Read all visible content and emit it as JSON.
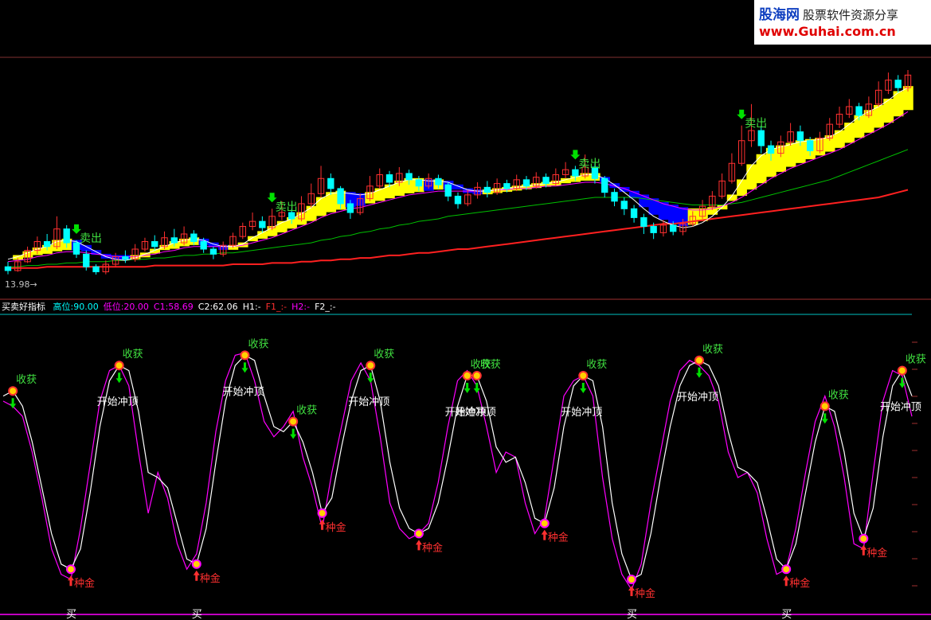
{
  "watermark": {
    "brand": "股海网",
    "slogan": "股票软件资源分享",
    "url": "www.Guhai.com.cn"
  },
  "price_panel": {
    "low_marker": "13.98",
    "sell_signal_label": "卖出",
    "colors": {
      "up": "#ff3030",
      "down": "#00ffff",
      "band_up": "#ffff00",
      "band_down": "#0000ff",
      "ma_white": "#ffffff",
      "ma_magenta": "#ff00ff",
      "ma_green": "#00c000",
      "ma_red": "#ff2020"
    }
  },
  "indicator_bar": {
    "name": "买卖好指标",
    "items": [
      {
        "label": "高位:",
        "value": "90.00",
        "color": "#00ffff"
      },
      {
        "label": "低位:",
        "value": "20.00",
        "color": "#ff00ff"
      },
      {
        "label": "C1:",
        "value": "58.69",
        "color": "#ff00ff"
      },
      {
        "label": "C2:",
        "value": "62.06",
        "color": "#ffffff"
      },
      {
        "label": "H1:",
        "value": "-",
        "color": "#ffffff"
      },
      {
        "label": "F1_:",
        "value": "-",
        "color": "#ff3030"
      },
      {
        "label": "H2:",
        "value": "-",
        "color": "#ff00ff"
      },
      {
        "label": "F2_:",
        "value": "-",
        "color": "#ffffff"
      }
    ]
  },
  "oscillator": {
    "harvest_label": "收获",
    "gold_label": "种金",
    "peak_label": "开始冲顶",
    "buy_label": "买",
    "colors": {
      "line1": "#ff00ff",
      "line2": "#ffffff",
      "harvest": "#40e040",
      "gold": "#ff3030",
      "peak": "#ffffff"
    }
  },
  "chart_data": {
    "type": "line",
    "candles": [
      {
        "o": 14.6,
        "c": 14.3,
        "h": 15.0,
        "l": 14.0
      },
      {
        "o": 14.3,
        "c": 15.0,
        "h": 15.3,
        "l": 14.2
      },
      {
        "o": 15.0,
        "c": 15.9,
        "h": 16.2,
        "l": 14.9
      },
      {
        "o": 15.9,
        "c": 16.6,
        "h": 17.0,
        "l": 15.6
      },
      {
        "o": 16.6,
        "c": 16.2,
        "h": 17.2,
        "l": 15.9
      },
      {
        "o": 16.2,
        "c": 17.6,
        "h": 18.6,
        "l": 16.0
      },
      {
        "o": 17.6,
        "c": 16.5,
        "h": 17.9,
        "l": 16.1
      },
      {
        "o": 16.5,
        "c": 15.6,
        "h": 16.7,
        "l": 15.3
      },
      {
        "o": 15.6,
        "c": 14.6,
        "h": 15.9,
        "l": 14.3
      },
      {
        "o": 14.6,
        "c": 14.2,
        "h": 14.8,
        "l": 13.98
      },
      {
        "o": 14.2,
        "c": 14.8,
        "h": 15.1,
        "l": 14.0
      },
      {
        "o": 14.8,
        "c": 15.4,
        "h": 15.7,
        "l": 14.6
      },
      {
        "o": 15.4,
        "c": 15.2,
        "h": 15.9,
        "l": 14.9
      },
      {
        "o": 15.2,
        "c": 16.0,
        "h": 16.4,
        "l": 15.0
      },
      {
        "o": 16.0,
        "c": 16.6,
        "h": 16.9,
        "l": 15.8
      },
      {
        "o": 16.6,
        "c": 16.2,
        "h": 17.1,
        "l": 15.9
      },
      {
        "o": 16.2,
        "c": 16.9,
        "h": 17.4,
        "l": 16.0
      },
      {
        "o": 16.9,
        "c": 16.5,
        "h": 17.6,
        "l": 16.2
      },
      {
        "o": 16.5,
        "c": 17.2,
        "h": 17.8,
        "l": 16.3
      },
      {
        "o": 17.2,
        "c": 16.6,
        "h": 17.5,
        "l": 16.3
      },
      {
        "o": 16.6,
        "c": 16.0,
        "h": 16.9,
        "l": 15.7
      },
      {
        "o": 16.0,
        "c": 15.6,
        "h": 16.2,
        "l": 15.2
      },
      {
        "o": 15.6,
        "c": 16.3,
        "h": 16.6,
        "l": 15.4
      },
      {
        "o": 16.3,
        "c": 17.0,
        "h": 17.3,
        "l": 16.1
      },
      {
        "o": 17.0,
        "c": 17.8,
        "h": 18.1,
        "l": 16.8
      },
      {
        "o": 17.8,
        "c": 18.2,
        "h": 18.9,
        "l": 17.5
      },
      {
        "o": 18.2,
        "c": 17.7,
        "h": 18.6,
        "l": 17.3
      },
      {
        "o": 17.7,
        "c": 18.6,
        "h": 19.2,
        "l": 17.5
      },
      {
        "o": 18.6,
        "c": 18.9,
        "h": 19.8,
        "l": 18.3
      },
      {
        "o": 18.9,
        "c": 18.4,
        "h": 19.2,
        "l": 18.0
      },
      {
        "o": 18.4,
        "c": 19.6,
        "h": 20.2,
        "l": 18.2
      },
      {
        "o": 19.6,
        "c": 20.4,
        "h": 21.2,
        "l": 19.3
      },
      {
        "o": 20.4,
        "c": 21.6,
        "h": 22.6,
        "l": 20.1
      },
      {
        "o": 21.6,
        "c": 20.8,
        "h": 22.0,
        "l": 20.3
      },
      {
        "o": 20.8,
        "c": 19.6,
        "h": 21.0,
        "l": 19.2
      },
      {
        "o": 19.6,
        "c": 18.9,
        "h": 19.9,
        "l": 18.4
      },
      {
        "o": 18.9,
        "c": 20.0,
        "h": 20.4,
        "l": 18.7
      },
      {
        "o": 20.0,
        "c": 21.0,
        "h": 21.8,
        "l": 19.8
      },
      {
        "o": 21.0,
        "c": 21.9,
        "h": 22.4,
        "l": 20.8
      },
      {
        "o": 21.9,
        "c": 21.3,
        "h": 22.2,
        "l": 20.9
      },
      {
        "o": 21.3,
        "c": 22.0,
        "h": 22.5,
        "l": 21.0
      },
      {
        "o": 22.0,
        "c": 21.5,
        "h": 22.3,
        "l": 21.1
      },
      {
        "o": 21.5,
        "c": 21.0,
        "h": 21.8,
        "l": 20.6
      },
      {
        "o": 21.0,
        "c": 21.6,
        "h": 22.0,
        "l": 20.8
      },
      {
        "o": 21.6,
        "c": 21.1,
        "h": 21.9,
        "l": 20.8
      },
      {
        "o": 21.1,
        "c": 20.2,
        "h": 21.3,
        "l": 19.8
      },
      {
        "o": 20.2,
        "c": 19.6,
        "h": 20.5,
        "l": 19.2
      },
      {
        "o": 19.6,
        "c": 20.3,
        "h": 20.7,
        "l": 19.4
      },
      {
        "o": 20.3,
        "c": 20.9,
        "h": 21.3,
        "l": 20.0
      },
      {
        "o": 20.9,
        "c": 20.5,
        "h": 21.4,
        "l": 20.1
      },
      {
        "o": 20.5,
        "c": 21.2,
        "h": 21.6,
        "l": 20.3
      },
      {
        "o": 21.2,
        "c": 20.8,
        "h": 21.5,
        "l": 20.5
      },
      {
        "o": 20.8,
        "c": 21.5,
        "h": 21.9,
        "l": 20.6
      },
      {
        "o": 21.5,
        "c": 21.0,
        "h": 21.8,
        "l": 20.7
      },
      {
        "o": 21.0,
        "c": 21.7,
        "h": 22.1,
        "l": 20.8
      },
      {
        "o": 21.7,
        "c": 21.2,
        "h": 22.0,
        "l": 20.9
      },
      {
        "o": 21.2,
        "c": 21.9,
        "h": 22.4,
        "l": 21.0
      },
      {
        "o": 21.9,
        "c": 22.3,
        "h": 22.9,
        "l": 21.6
      },
      {
        "o": 22.3,
        "c": 21.8,
        "h": 22.6,
        "l": 21.4
      },
      {
        "o": 21.8,
        "c": 22.5,
        "h": 23.5,
        "l": 21.6
      },
      {
        "o": 22.5,
        "c": 21.6,
        "h": 22.8,
        "l": 21.2
      },
      {
        "o": 21.6,
        "c": 20.5,
        "h": 21.8,
        "l": 20.1
      },
      {
        "o": 20.5,
        "c": 19.8,
        "h": 20.8,
        "l": 19.4
      },
      {
        "o": 19.8,
        "c": 19.2,
        "h": 20.1,
        "l": 18.7
      },
      {
        "o": 19.2,
        "c": 18.5,
        "h": 19.5,
        "l": 18.1
      },
      {
        "o": 18.5,
        "c": 17.8,
        "h": 18.8,
        "l": 17.2
      },
      {
        "o": 17.8,
        "c": 17.3,
        "h": 18.1,
        "l": 16.8
      },
      {
        "o": 17.3,
        "c": 17.9,
        "h": 18.3,
        "l": 17.0
      },
      {
        "o": 17.9,
        "c": 17.4,
        "h": 18.2,
        "l": 17.1
      },
      {
        "o": 17.4,
        "c": 18.0,
        "h": 18.4,
        "l": 17.1
      },
      {
        "o": 18.0,
        "c": 18.6,
        "h": 19.0,
        "l": 17.8
      },
      {
        "o": 18.6,
        "c": 19.4,
        "h": 19.9,
        "l": 18.4
      },
      {
        "o": 19.4,
        "c": 20.2,
        "h": 20.6,
        "l": 19.1
      },
      {
        "o": 20.2,
        "c": 21.4,
        "h": 22.0,
        "l": 20.0
      },
      {
        "o": 21.4,
        "c": 22.8,
        "h": 23.6,
        "l": 21.2
      },
      {
        "o": 22.8,
        "c": 24.6,
        "h": 25.8,
        "l": 22.6
      },
      {
        "o": 24.6,
        "c": 25.4,
        "h": 27.5,
        "l": 24.1
      },
      {
        "o": 25.4,
        "c": 24.2,
        "h": 25.8,
        "l": 23.6
      },
      {
        "o": 24.2,
        "c": 23.6,
        "h": 24.6,
        "l": 23.0
      },
      {
        "o": 23.6,
        "c": 24.5,
        "h": 25.0,
        "l": 23.3
      },
      {
        "o": 24.5,
        "c": 25.3,
        "h": 26.0,
        "l": 24.2
      },
      {
        "o": 25.3,
        "c": 24.6,
        "h": 25.8,
        "l": 24.2
      },
      {
        "o": 24.6,
        "c": 23.8,
        "h": 24.9,
        "l": 23.4
      },
      {
        "o": 23.8,
        "c": 24.8,
        "h": 25.3,
        "l": 23.6
      },
      {
        "o": 24.8,
        "c": 25.9,
        "h": 26.4,
        "l": 24.6
      },
      {
        "o": 25.9,
        "c": 26.7,
        "h": 27.3,
        "l": 25.6
      },
      {
        "o": 26.7,
        "c": 27.3,
        "h": 27.9,
        "l": 26.4
      },
      {
        "o": 27.3,
        "c": 26.6,
        "h": 27.6,
        "l": 26.2
      },
      {
        "o": 26.6,
        "c": 27.5,
        "h": 28.1,
        "l": 26.4
      },
      {
        "o": 27.5,
        "c": 28.6,
        "h": 29.3,
        "l": 27.3
      },
      {
        "o": 28.6,
        "c": 29.4,
        "h": 30.0,
        "l": 28.3
      },
      {
        "o": 29.4,
        "c": 28.8,
        "h": 29.8,
        "l": 28.4
      },
      {
        "o": 28.8,
        "c": 29.8,
        "h": 30.2,
        "l": 28.5
      }
    ],
    "ma_white": [
      15.2,
      15.4,
      15.7,
      16.0,
      16.2,
      16.6,
      16.7,
      16.6,
      16.2,
      15.8,
      15.4,
      15.2,
      15.1,
      15.3,
      15.6,
      15.9,
      16.2,
      16.5,
      16.7,
      16.8,
      16.7,
      16.4,
      16.2,
      16.2,
      16.4,
      16.9,
      17.3,
      17.7,
      18.1,
      18.4,
      18.8,
      19.3,
      20.0,
      20.4,
      20.5,
      20.4,
      20.3,
      20.4,
      20.7,
      21.0,
      21.3,
      21.5,
      21.5,
      21.4,
      21.4,
      21.3,
      21.0,
      20.7,
      20.6,
      20.6,
      20.7,
      20.8,
      20.9,
      21.0,
      21.1,
      21.2,
      21.3,
      21.5,
      21.7,
      21.9,
      21.9,
      21.6,
      21.1,
      20.5,
      19.9,
      19.2,
      18.6,
      18.2,
      17.9,
      17.7,
      17.8,
      18.1,
      18.6,
      19.3,
      20.2,
      21.4,
      22.6,
      23.4,
      23.9,
      24.1,
      24.3,
      24.5,
      24.6,
      24.7,
      24.9,
      25.3,
      25.9,
      26.5,
      26.9,
      27.3,
      27.8,
      28.4,
      28.8
    ],
    "ma_magenta": [
      15.0,
      15.1,
      15.2,
      15.4,
      15.5,
      15.7,
      15.8,
      15.8,
      15.7,
      15.6,
      15.5,
      15.4,
      15.4,
      15.4,
      15.5,
      15.6,
      15.8,
      15.9,
      16.1,
      16.2,
      16.2,
      16.2,
      16.2,
      16.2,
      16.3,
      16.5,
      16.7,
      16.9,
      17.2,
      17.5,
      17.8,
      18.1,
      18.5,
      18.8,
      19.0,
      19.2,
      19.3,
      19.5,
      19.7,
      19.9,
      20.1,
      20.3,
      20.4,
      20.5,
      20.6,
      20.6,
      20.6,
      20.6,
      20.6,
      20.6,
      20.7,
      20.7,
      20.8,
      20.8,
      20.9,
      21.0,
      21.0,
      21.1,
      21.2,
      21.3,
      21.3,
      21.2,
      21.0,
      20.8,
      20.5,
      20.2,
      19.9,
      19.6,
      19.4,
      19.2,
      19.1,
      19.1,
      19.2,
      19.4,
      19.7,
      20.1,
      20.6,
      21.1,
      21.6,
      22.0,
      22.4,
      22.7,
      23.0,
      23.3,
      23.6,
      23.9,
      24.3,
      24.7,
      25.1,
      25.5,
      25.9,
      26.4,
      26.9
    ],
    "ma_green": [
      14.6,
      14.6,
      14.7,
      14.7,
      14.8,
      14.8,
      14.9,
      14.9,
      15.0,
      15.0,
      15.0,
      15.1,
      15.1,
      15.2,
      15.2,
      15.3,
      15.3,
      15.4,
      15.5,
      15.5,
      15.6,
      15.6,
      15.7,
      15.7,
      15.8,
      15.9,
      16.0,
      16.1,
      16.2,
      16.3,
      16.4,
      16.5,
      16.7,
      16.8,
      17.0,
      17.1,
      17.3,
      17.4,
      17.6,
      17.7,
      17.9,
      18.0,
      18.2,
      18.3,
      18.4,
      18.6,
      18.7,
      18.8,
      18.9,
      19.0,
      19.1,
      19.2,
      19.3,
      19.4,
      19.5,
      19.6,
      19.7,
      19.8,
      19.9,
      20.0,
      20.1,
      20.1,
      20.1,
      20.1,
      20.1,
      20.0,
      19.9,
      19.8,
      19.7,
      19.6,
      19.5,
      19.5,
      19.5,
      19.5,
      19.6,
      19.7,
      19.9,
      20.1,
      20.3,
      20.5,
      20.7,
      20.9,
      21.1,
      21.3,
      21.5,
      21.8,
      22.1,
      22.4,
      22.7,
      23.0,
      23.3,
      23.6,
      23.9
    ],
    "ma_red": [
      14.5,
      14.5,
      14.5,
      14.5,
      14.6,
      14.6,
      14.6,
      14.6,
      14.6,
      14.6,
      14.6,
      14.6,
      14.6,
      14.6,
      14.6,
      14.7,
      14.7,
      14.7,
      14.7,
      14.7,
      14.7,
      14.7,
      14.7,
      14.8,
      14.8,
      14.8,
      14.8,
      14.9,
      14.9,
      14.9,
      15.0,
      15.0,
      15.1,
      15.1,
      15.2,
      15.2,
      15.3,
      15.3,
      15.4,
      15.5,
      15.5,
      15.6,
      15.7,
      15.7,
      15.8,
      15.9,
      16.0,
      16.0,
      16.1,
      16.2,
      16.3,
      16.4,
      16.5,
      16.6,
      16.7,
      16.8,
      16.9,
      17.0,
      17.1,
      17.2,
      17.3,
      17.4,
      17.5,
      17.6,
      17.7,
      17.8,
      17.9,
      18.0,
      18.0,
      18.1,
      18.2,
      18.3,
      18.4,
      18.5,
      18.6,
      18.7,
      18.8,
      18.9,
      19.0,
      19.1,
      19.2,
      19.3,
      19.4,
      19.5,
      19.6,
      19.7,
      19.8,
      19.9,
      20.0,
      20.1,
      20.3,
      20.5,
      20.7
    ],
    "sell_signal_candles": [
      7,
      27,
      58,
      75
    ],
    "oscillator_purple": [
      80,
      78,
      74,
      60,
      42,
      22,
      12,
      10,
      30,
      55,
      80,
      92,
      94,
      86,
      60,
      36,
      52,
      42,
      24,
      14,
      20,
      40,
      68,
      88,
      98,
      99,
      88,
      72,
      66,
      70,
      76,
      58,
      46,
      30,
      52,
      70,
      88,
      95,
      88,
      66,
      40,
      30,
      26,
      28,
      32,
      48,
      70,
      88,
      92,
      86,
      70,
      52,
      60,
      58,
      40,
      28,
      34,
      58,
      82,
      88,
      90,
      82,
      50,
      26,
      12,
      6,
      16,
      40,
      60,
      80,
      92,
      96,
      94,
      90,
      80,
      60,
      50,
      52,
      44,
      26,
      12,
      14,
      30,
      52,
      72,
      82,
      70,
      50,
      24,
      22,
      52,
      80,
      92,
      90,
      74
    ],
    "oscillator_white": [
      82,
      84,
      78,
      64,
      46,
      28,
      16,
      14,
      22,
      44,
      70,
      88,
      94,
      92,
      76,
      52,
      50,
      46,
      32,
      18,
      16,
      30,
      56,
      80,
      94,
      98,
      96,
      82,
      70,
      68,
      72,
      64,
      52,
      36,
      42,
      62,
      80,
      92,
      94,
      80,
      56,
      38,
      30,
      28,
      30,
      40,
      58,
      78,
      90,
      90,
      80,
      62,
      56,
      58,
      48,
      34,
      32,
      46,
      70,
      86,
      90,
      88,
      70,
      40,
      20,
      10,
      12,
      28,
      50,
      70,
      86,
      94,
      96,
      94,
      86,
      68,
      54,
      52,
      48,
      34,
      18,
      14,
      24,
      44,
      64,
      78,
      76,
      60,
      36,
      26,
      38,
      66,
      86,
      92,
      82
    ],
    "osc_ylim": [
      0,
      100
    ],
    "price_ylim": [
      13.98,
      30.2
    ]
  }
}
